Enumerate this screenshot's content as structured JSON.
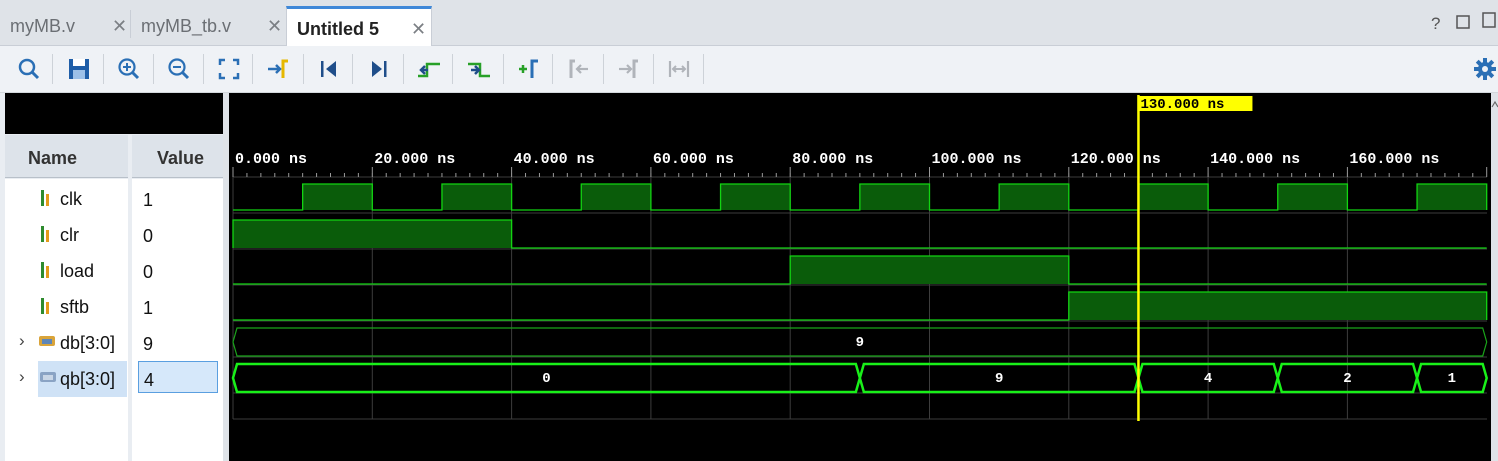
{
  "tabs": [
    {
      "label": "myMB.v",
      "active": false
    },
    {
      "label": "myMB_tb.v",
      "active": false
    },
    {
      "label": "Untitled 5",
      "active": true
    }
  ],
  "window_controls": {
    "help": "?"
  },
  "toolbar": {
    "icons": [
      "search-icon",
      "save-icon",
      "zoom-in-icon",
      "zoom-out-icon",
      "zoom-fit-icon",
      "go-to-cursor-icon",
      "go-to-time-0-icon",
      "go-to-last-time-icon",
      "previous-transition-icon",
      "next-transition-icon",
      "add-marker-icon",
      "previous-marker-icon",
      "next-marker-icon",
      "swap-cursors-icon",
      "settings-icon"
    ]
  },
  "columns": {
    "name": "Name",
    "value": "Value"
  },
  "signals": [
    {
      "name": "clk",
      "value": "1",
      "type": "bit"
    },
    {
      "name": "clr",
      "value": "0",
      "type": "bit"
    },
    {
      "name": "load",
      "value": "0",
      "type": "bit"
    },
    {
      "name": "sftb",
      "value": "1",
      "type": "bit"
    },
    {
      "name": "db[3:0]",
      "value": "9",
      "type": "bus"
    },
    {
      "name": "qb[3:0]",
      "value": "4",
      "type": "bus",
      "selected": true
    }
  ],
  "timeline": {
    "ticks": [
      "0.000 ns",
      "20.000 ns",
      "40.000 ns",
      "60.000 ns",
      "80.000 ns",
      "100.000 ns",
      "120.000 ns",
      "140.000 ns",
      "160.000 ns"
    ],
    "cursor_label": "130.000 ns",
    "cursor_time_ns": 130,
    "range_ns": [
      0,
      180
    ]
  },
  "waves": {
    "clk_high_intervals_ns": [
      [
        10,
        20
      ],
      [
        30,
        40
      ],
      [
        50,
        60
      ],
      [
        70,
        80
      ],
      [
        90,
        100
      ],
      [
        110,
        120
      ],
      [
        130,
        140
      ],
      [
        150,
        160
      ],
      [
        170,
        180
      ]
    ],
    "clr_high_intervals_ns": [
      [
        0,
        40
      ]
    ],
    "load_high_intervals_ns": [
      [
        80,
        120
      ]
    ],
    "sftb_high_intervals_ns": [
      [
        120,
        180
      ]
    ],
    "db_segments": [
      {
        "start": 0,
        "end": 180,
        "label": "9"
      }
    ],
    "qb_segments": [
      {
        "start": 0,
        "end": 90,
        "label": "0"
      },
      {
        "start": 90,
        "end": 130,
        "label": "9"
      },
      {
        "start": 130,
        "end": 150,
        "label": "4"
      },
      {
        "start": 150,
        "end": 170,
        "label": "2"
      },
      {
        "start": 170,
        "end": 180,
        "label": "1"
      }
    ]
  },
  "colors": {
    "high_fill": "#0a5c0a",
    "trace": "#12d412",
    "bus_active": "#19f019",
    "cursor": "#ffff00",
    "grid": "#3d3d3d",
    "background": "#000000"
  }
}
